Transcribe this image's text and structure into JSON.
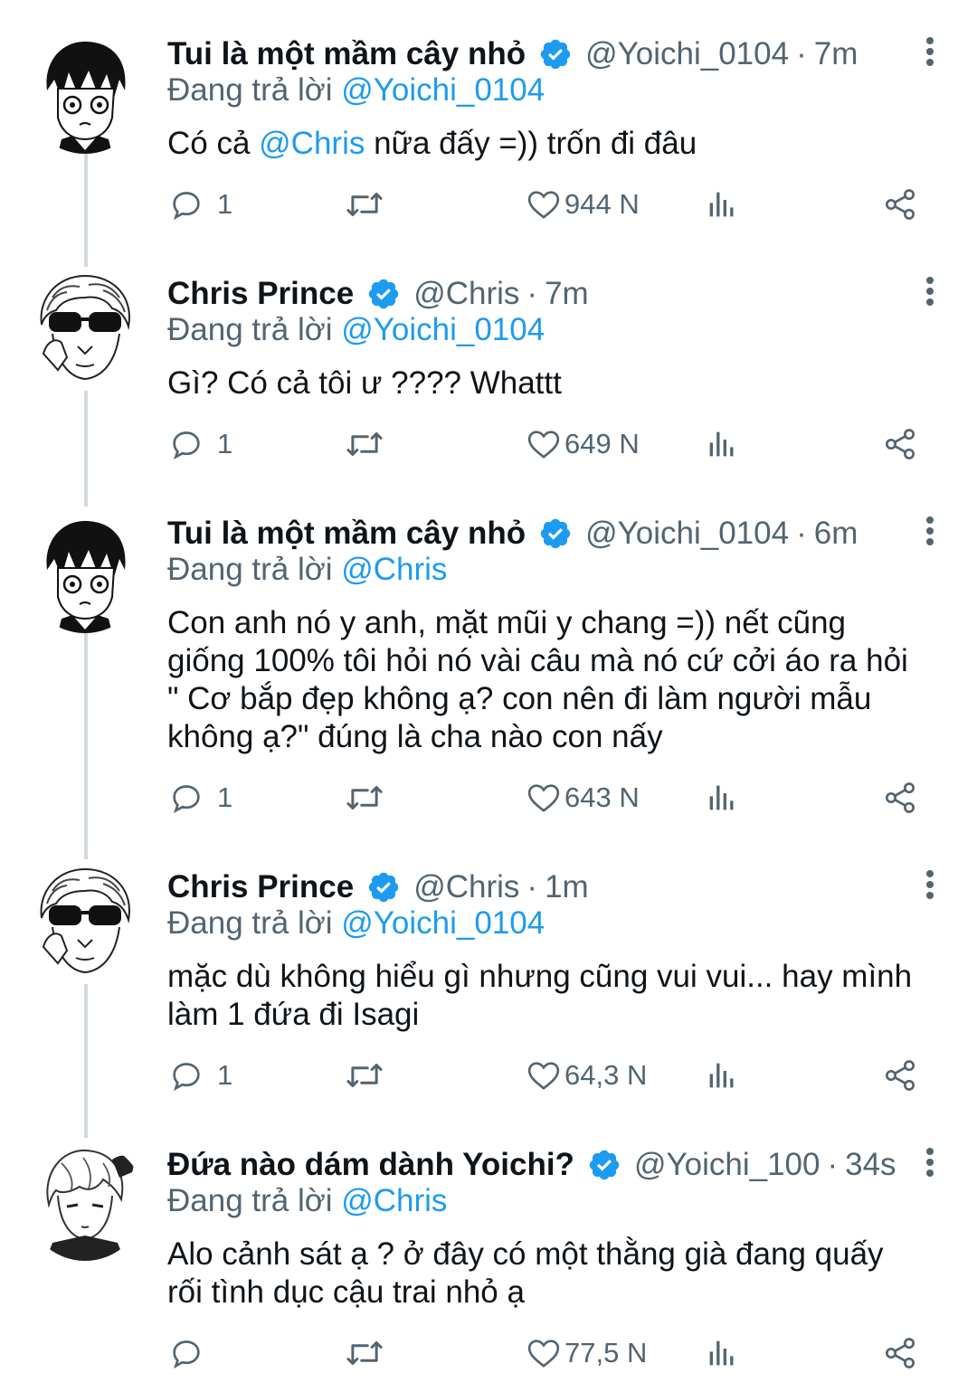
{
  "tweets": [
    {
      "name": "Tui là một mầm cây nhỏ",
      "handle": "@Yoichi_0104",
      "time": "7m",
      "reply_prefix": "Đang trả lời",
      "reply_to": "@Yoichi_0104",
      "text_before": "Có cả ",
      "text_mention": "@Chris",
      "text_after": " nữa đấy =)) trốn đi đâu",
      "replies": "1",
      "likes": "944 N"
    },
    {
      "name": "Chris Prince",
      "handle": "@Chris",
      "time": "7m",
      "reply_prefix": "Đang trả lời",
      "reply_to": "@Yoichi_0104",
      "text": "Gì? Có cả tôi ư ???? Whattt",
      "replies": "1",
      "likes": "649 N"
    },
    {
      "name": "Tui là một mầm cây nhỏ",
      "handle": "@Yoichi_0104",
      "time": "6m",
      "reply_prefix": "Đang trả lời",
      "reply_to": "@Chris",
      "text_lines": [
        "Con anh nó y anh, mặt mũi y chang =)) nết cũng",
        "giống 100% tôi hỏi nó vài câu mà nó cứ cởi áo ra hỏi",
        "\" Cơ bắp đẹp không ạ? con nên đi làm người mẫu",
        "không ạ?\" đúng là cha nào con nấy"
      ],
      "replies": "1",
      "likes": "643 N"
    },
    {
      "name": "Chris Prince",
      "handle": "@Chris",
      "time": "1m",
      "reply_prefix": "Đang trả lời",
      "reply_to": "@Yoichi_0104",
      "text_lines": [
        "mặc dù không hiểu gì nhưng cũng vui vui... hay mình",
        "làm 1 đứa đi Isagi"
      ],
      "replies": "1",
      "likes": "64,3 N"
    },
    {
      "name": "Đứa nào dám dành Yoichi?",
      "handle": "@Yoichi_100",
      "time": "34s",
      "reply_prefix": "Đang trả lời",
      "reply_to": "@Chris",
      "text_lines": [
        "Alo cảnh sát ạ ? ở đây có một thằng già đang quấy",
        "rối tình dục cậu trai nhỏ ạ"
      ],
      "replies": "",
      "likes": "77,5 N"
    }
  ],
  "icons": {
    "reply": "speech-bubble-icon",
    "retweet": "retweet-icon",
    "like": "heart-icon",
    "views": "bar-chart-icon",
    "share": "share-icon",
    "verified": "verified-badge-icon",
    "more": "more-vertical-icon"
  },
  "colors": {
    "mention": "#1d9bf0",
    "secondary_text": "#536471",
    "verified": "#1d9bf0",
    "thread_line": "#cfd9de"
  }
}
